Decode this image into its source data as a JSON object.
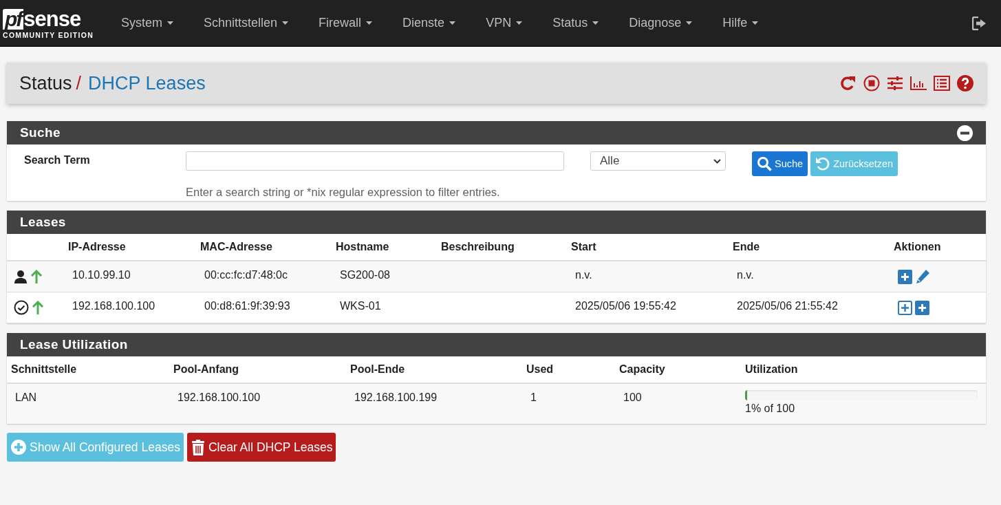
{
  "logo": {
    "mark": "pf",
    "name": "sense",
    "edition": "COMMUNITY EDITION"
  },
  "nav": [
    {
      "label": "System"
    },
    {
      "label": "Schnittstellen"
    },
    {
      "label": "Firewall"
    },
    {
      "label": "Dienste"
    },
    {
      "label": "VPN"
    },
    {
      "label": "Status"
    },
    {
      "label": "Diagnose"
    },
    {
      "label": "Hilfe"
    }
  ],
  "breadcrumb": {
    "parent": "Status",
    "separator": "/",
    "current": "DHCP Leases"
  },
  "search": {
    "title": "Suche",
    "label": "Search Term",
    "filter": "Alle",
    "search_button": "Suche",
    "reset_button": "Zurücksetzen",
    "help": "Enter a search string or *nix regular expression to filter entries."
  },
  "leases": {
    "title": "Leases",
    "columns": [
      "IP-Adresse",
      "MAC-Adresse",
      "Hostname",
      "Beschreibung",
      "Start",
      "Ende",
      "Aktionen"
    ],
    "rows": [
      {
        "kind": "static",
        "online": true,
        "ip": "10.10.99.10",
        "mac": "00:cc:fc:d7:48:0c",
        "hostname": "SG200-08",
        "start": "n.v.",
        "end": "n.v."
      },
      {
        "kind": "active",
        "online": true,
        "ip": "192.168.100.100",
        "mac": "00:d8:61:9f:39:93",
        "hostname": "WKS-01",
        "start": "2025/05/06 19:55:42",
        "end": "2025/05/06 21:55:42"
      }
    ]
  },
  "utilization": {
    "title": "Lease Utilization",
    "columns": [
      "Schnittstelle",
      "Pool-Anfang",
      "Pool-Ende",
      "Used",
      "Capacity",
      "Utilization"
    ],
    "rows": [
      {
        "interface": "LAN",
        "pool_start": "192.168.100.100",
        "pool_end": "192.168.100.199",
        "used": "1",
        "capacity": "100",
        "level": 0.01,
        "reading": "1% of 100"
      }
    ]
  },
  "buttons": [
    {
      "kind": "show",
      "label": "Show All Configured Leases"
    },
    {
      "kind": "clear",
      "label": "Clear All DHCP Leases"
    }
  ]
}
